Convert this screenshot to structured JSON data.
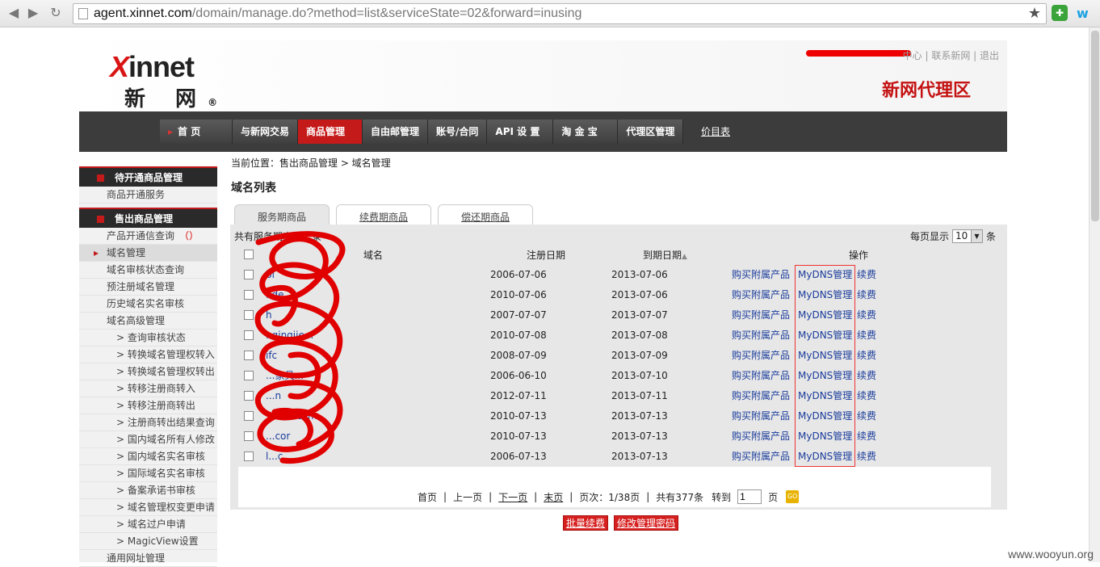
{
  "browser": {
    "url_host": "agent.xinnet.com",
    "url_rest": "/domain/manage.do?method=list&serviceState=02&forward=inusing"
  },
  "header": {
    "logo_en": "innet",
    "logo_x": "X",
    "logo_cn": "新 网",
    "logo_reg": "®",
    "top_links": "中心 | 联系新网 | 退出",
    "zone_title": "新网代理区"
  },
  "nav": {
    "items": [
      "首 页",
      "与新网交易",
      "商品管理",
      "自由邮管理",
      "账号/合同",
      "API 设 置",
      "淘 金 宝",
      "代理区管理"
    ],
    "price_link": "价目表"
  },
  "sidebar": {
    "section1": "待开通商品管理",
    "section1_items": [
      "商品开通服务"
    ],
    "section2": "售出商品管理",
    "items": [
      {
        "label": "产品开通信查询",
        "extra": "（）",
        "sub": false
      },
      {
        "label": "域名管理",
        "sub": false,
        "active": true
      },
      {
        "label": "域名审核状态查询",
        "sub": false
      },
      {
        "label": "预注册域名管理",
        "sub": false
      },
      {
        "label": "历史域名实名审核",
        "sub": false
      },
      {
        "label": "域名高级管理",
        "sub": false
      },
      {
        "label": "> 查询审核状态",
        "sub": true
      },
      {
        "label": "> 转换域名管理权转入",
        "sub": true
      },
      {
        "label": "> 转换域名管理权转出",
        "sub": true
      },
      {
        "label": "> 转移注册商转入",
        "sub": true
      },
      {
        "label": "> 转移注册商转出",
        "sub": true
      },
      {
        "label": "> 注册商转出结果查询",
        "sub": true
      },
      {
        "label": "> 国内域名所有人修改",
        "sub": true
      },
      {
        "label": "> 国内域名实名审核",
        "sub": true
      },
      {
        "label": "> 国际域名实名审核",
        "sub": true
      },
      {
        "label": "> 备案承诺书审核",
        "sub": true
      },
      {
        "label": "> 域名管理权变更申请",
        "sub": true
      },
      {
        "label": "> 域名过户申请",
        "sub": true
      },
      {
        "label": "> MagicView设置",
        "sub": true
      },
      {
        "label": "通用网址管理",
        "sub": false
      }
    ]
  },
  "main": {
    "breadcrumb": "当前位置：售出商品管理 > 域名管理",
    "title": "域名列表",
    "tabs": [
      "服务期商品",
      "续费期商品",
      "偿还期商品"
    ],
    "record_label": "共有服务期商品记录",
    "per_page_label": "每页显示",
    "per_page_value": "10",
    "per_page_unit": "条",
    "columns": {
      "domain": "域名",
      "reg_date": "注册日期",
      "exp_date": "到期日期",
      "sort_icon": "▲",
      "ops": "操作"
    },
    "actions": {
      "buy": "购买附属产品",
      "mydns": "MyDNS管理",
      "renew": "续费"
    },
    "rows": [
      {
        "domain": "bi",
        "reg": "2006-07-06",
        "exp": "2013-07-06"
      },
      {
        "domain": "fide",
        "reg": "2010-07-06",
        "exp": "2013-07-06"
      },
      {
        "domain": "h",
        "reg": "2007-07-07",
        "exp": "2013-07-07"
      },
      {
        "domain": "..qingjie...",
        "reg": "2010-07-08",
        "exp": "2013-07-08"
      },
      {
        "domain": "ifc",
        "reg": "2008-07-09",
        "exp": "2013-07-09"
      },
      {
        "domain": "...家具...",
        "reg": "2006-06-10",
        "exp": "2013-07-10"
      },
      {
        "domain": "...n",
        "reg": "2012-07-11",
        "exp": "2013-07-11"
      },
      {
        "domain": "...du...com",
        "reg": "2010-07-13",
        "exp": "2013-07-13"
      },
      {
        "domain": "...cor",
        "reg": "2010-07-13",
        "exp": "2013-07-13"
      },
      {
        "domain": "l...c",
        "reg": "2006-07-13",
        "exp": "2013-07-13"
      }
    ],
    "pager": {
      "first": "首页",
      "prev": "上一页",
      "next": "下一页",
      "last": "末页",
      "page_info": "页次：1/38页",
      "total": "共有377条",
      "goto": "转到",
      "page_value": "1",
      "page_unit": "页",
      "go": "GO"
    },
    "buttons": {
      "batch_renew": "批量续费",
      "change_pwd": "修改管理密码"
    }
  },
  "watermark": "www.wooyun.org",
  "colors": {
    "brand_red": "#c41a1a",
    "nav_dark": "#3c3c3c",
    "link": "#1a3c9c"
  }
}
